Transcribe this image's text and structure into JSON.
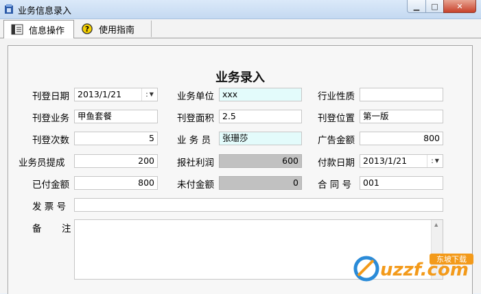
{
  "window": {
    "title": "业务信息录入",
    "min": "▁",
    "max": "□",
    "close": "✕"
  },
  "tabs": [
    {
      "label": "信息操作"
    },
    {
      "label": "使用指南"
    }
  ],
  "form": {
    "heading": "业务录入",
    "labels": {
      "publish_date": "刊登日期",
      "business_unit": "业务单位",
      "industry": "行业性质",
      "publish_business": "刊登业务",
      "publish_area": "刊登面积",
      "publish_position": "刊登位置",
      "publish_times": "刊登次数",
      "salesperson": "业 务 员",
      "ad_amount": "广告金额",
      "commission": "业务员提成",
      "profit": "报社利润",
      "payment_date": "付款日期",
      "paid": "已付金额",
      "unpaid": "未付金额",
      "contract_no": "合 同 号",
      "invoice_no": "发 票 号",
      "note_a": "备",
      "note_b": "注"
    },
    "values": {
      "publish_date": "2013/1/21",
      "business_unit": "xxx",
      "industry": "",
      "publish_business": "甲鱼套餐",
      "publish_area": "2.5",
      "publish_position": "第一版",
      "publish_times": "5",
      "salesperson": "张珊莎",
      "ad_amount": "800",
      "commission": "200",
      "profit": "600",
      "payment_date": "2013/1/21",
      "paid": "800",
      "unpaid": "0",
      "contract_no": "001",
      "invoice_no": "",
      "note": ""
    },
    "date_dropdown": {
      "colon": ":",
      "arrow": "▼"
    }
  },
  "watermark": {
    "brand": "uzzf.com",
    "tag": "东坡下载"
  },
  "colors": {
    "highlight_field": "#e3fbfb",
    "readonly_field": "#c1c1c1"
  }
}
